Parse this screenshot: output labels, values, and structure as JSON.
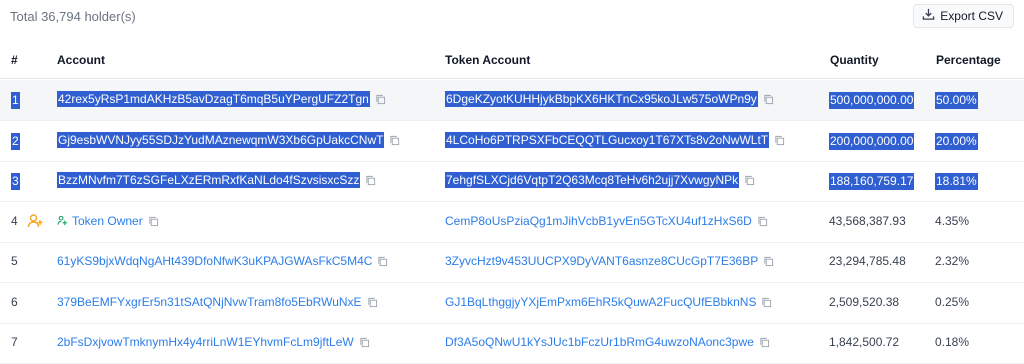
{
  "header": {
    "total": "Total 36,794 holder(s)",
    "export_label": "Export CSV"
  },
  "columns": {
    "index": "#",
    "account": "Account",
    "token_account": "Token Account",
    "quantity": "Quantity",
    "percentage": "Percentage"
  },
  "rows": [
    {
      "index": "1",
      "account": "42rex5yRsP1mdAKHzB5avDzagT6mqB5uYPergUFZ2Tgn",
      "token_account": "6DgeKZyotKUHHjykBbpKX6HKTnCx95koJLw575oWPn9y",
      "quantity": "500,000,000.00",
      "percentage": "50.00%"
    },
    {
      "index": "2",
      "account": "Gj9esbWVNJyy55SDJzYudMAznewqmW3Xb6GpUakcCNwT",
      "token_account": "4LCoHo6PTRPSXFbCEQQTLGucxoy1T67XTs8v2oNwWLtT",
      "quantity": "200,000,000.00",
      "percentage": "20.00%"
    },
    {
      "index": "3",
      "account": "BzzMNvfm7T6zSGFeLXzERmRxfKaNLdo4fSzvsisxcSzz",
      "token_account": "7ehgfSLXCjd6VqtpT2Q63Mcq8TeHv6h2ujj7XvwgyNPk",
      "quantity": "188,160,759.17",
      "percentage": "18.81%"
    },
    {
      "index": "4",
      "account": "Token Owner",
      "token_account": "CemP8oUsPziaQg1mJihVcbB1yvEn5GTcXU4uf1zHxS6D",
      "quantity": "43,568,387.93",
      "percentage": "4.35%"
    },
    {
      "index": "5",
      "account": "61yKS9bjxWdqNgAHt439DfoNfwK3uKPAJGWAsFkC5M4C",
      "token_account": "3ZyvcHzt9v453UUCPX9DyVANT6asnze8CUcGpT7E36BP",
      "quantity": "23,294,785.48",
      "percentage": "2.32%"
    },
    {
      "index": "6",
      "account": "379BeEMFYxgrEr5n31tSAtQNjNvwTram8fo5EbRWuNxE",
      "token_account": "GJ1BqLthggjyYXjEmPxm6EhR5kQuwA2FucQUfEBbknNS",
      "quantity": "2,509,520.38",
      "percentage": "0.25%"
    },
    {
      "index": "7",
      "account": "2bFsDxjvowTmknymHx4y4rriLnW1EYhvmFcLm9jftLeW",
      "token_account": "Df3A5oQNwU1kYsJUc1bFczUr1bRmG4uwzoNAonc3pwe",
      "quantity": "1,842,500.72",
      "percentage": "0.18%"
    }
  ],
  "colors": {
    "link": "#2b7de9",
    "selection": "#2f5fd0",
    "owner_icon": "#f5a623",
    "owner_small_icon": "#22a06b"
  },
  "icons": [
    "download-icon",
    "copy-icon",
    "add-user-icon",
    "owner-icon"
  ]
}
